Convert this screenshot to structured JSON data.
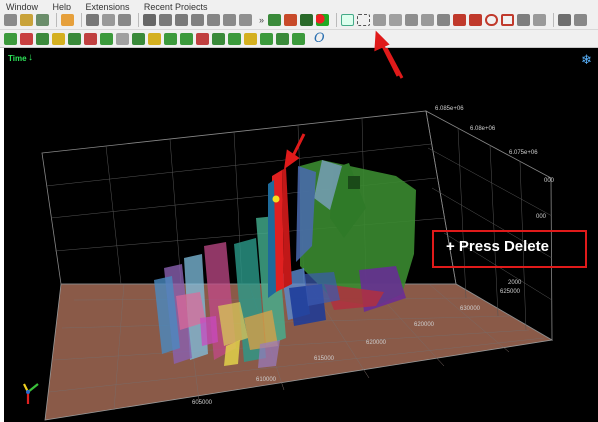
{
  "menubar": {
    "items": [
      "Window",
      "Help",
      "Extensions",
      "Recent Projects"
    ]
  },
  "viewport": {
    "time_label": "Time",
    "axis_labels": {
      "back_right_1": "6.085e+06",
      "back_right_2": "6.08e+06",
      "back_right_3": "6.075e+06",
      "right_1": "000",
      "right_2": "2000",
      "front_1": "625000",
      "front_2": "630000",
      "front_3": "620000",
      "front_4": "615000",
      "front_5": "610000",
      "front_6": "605000"
    }
  },
  "annotation": {
    "callout_text": "+ Press Delete",
    "colors": {
      "highlight": "#e01a1a",
      "time": "#2ee65a"
    }
  },
  "icons": {
    "toolbar1": [
      "open-icon",
      "save-icon",
      "layers-icon",
      "image-icon",
      "edit-icon",
      "scissors-icon",
      "move-icon",
      "warning-icon",
      "undo-icon",
      "redo-icon",
      "refresh-icon",
      "pan-icon",
      "vertical-icon",
      "more-icon",
      "seismic-icon",
      "well-icon",
      "fault-icon",
      "color-icon",
      "pointer-icon",
      "rect-select-icon",
      "plus-icon",
      "hand-icon",
      "zoom-icon",
      "fit-icon",
      "erase-icon",
      "lasso-icon",
      "polygon-icon",
      "ellipse-icon",
      "rect-icon",
      "save-view-icon",
      "triangle-icon",
      "camera-icon",
      "copy-icon"
    ],
    "toolbar2_orientation": "orient-icon"
  }
}
